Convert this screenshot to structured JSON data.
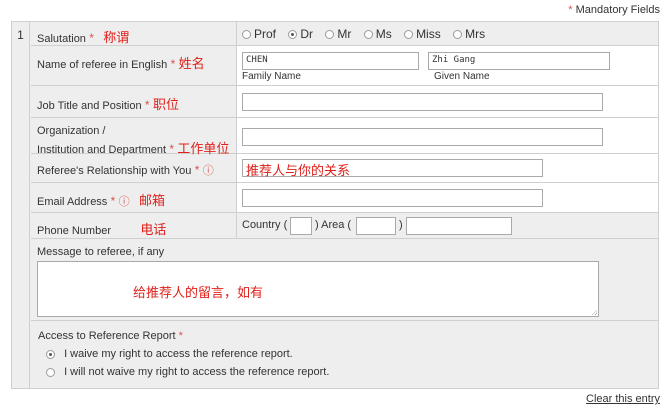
{
  "mandatory_note": "Mandatory Fields",
  "entry_number": "1",
  "salutation": {
    "label": "Salutation",
    "cn": "称谓",
    "options": [
      "Prof",
      "Dr",
      "Mr",
      "Ms",
      "Miss",
      "Mrs"
    ],
    "selected": "Dr"
  },
  "name": {
    "label": "Name of referee in English",
    "cn": "姓名",
    "family_value": "CHEN",
    "family_caption": "Family Name",
    "given_value": "Zhi Gang",
    "given_caption": "Given Name"
  },
  "job": {
    "label": "Job Title and Position",
    "cn": "职位"
  },
  "org": {
    "label_line1": "Organization /",
    "label_line2": "Institution and Department",
    "cn": "工作单位"
  },
  "relationship": {
    "label": "Referee's Relationship with You",
    "hint": "推荐人与你的关系"
  },
  "email": {
    "label": "Email Address",
    "cn": "邮箱"
  },
  "phone": {
    "label": "Phone Number",
    "cn": "电话",
    "country_label": "Country (",
    "area_label": ") Area (",
    "close_paren": ")"
  },
  "message": {
    "label": "Message to referee, if any",
    "hint": "给推荐人的留言，如有"
  },
  "access": {
    "label": "Access to Reference Report",
    "options": [
      "I waive my right to access the reference report.",
      "I will not waive my right to access the reference report."
    ],
    "selected_index": 0
  },
  "clear_link": "Clear this entry",
  "colors": {
    "required": "#d9534f",
    "chinese_annotation": "#e0201b",
    "panel_bg": "#eeeeee"
  },
  "icons": {
    "info": "info-circle-icon"
  }
}
